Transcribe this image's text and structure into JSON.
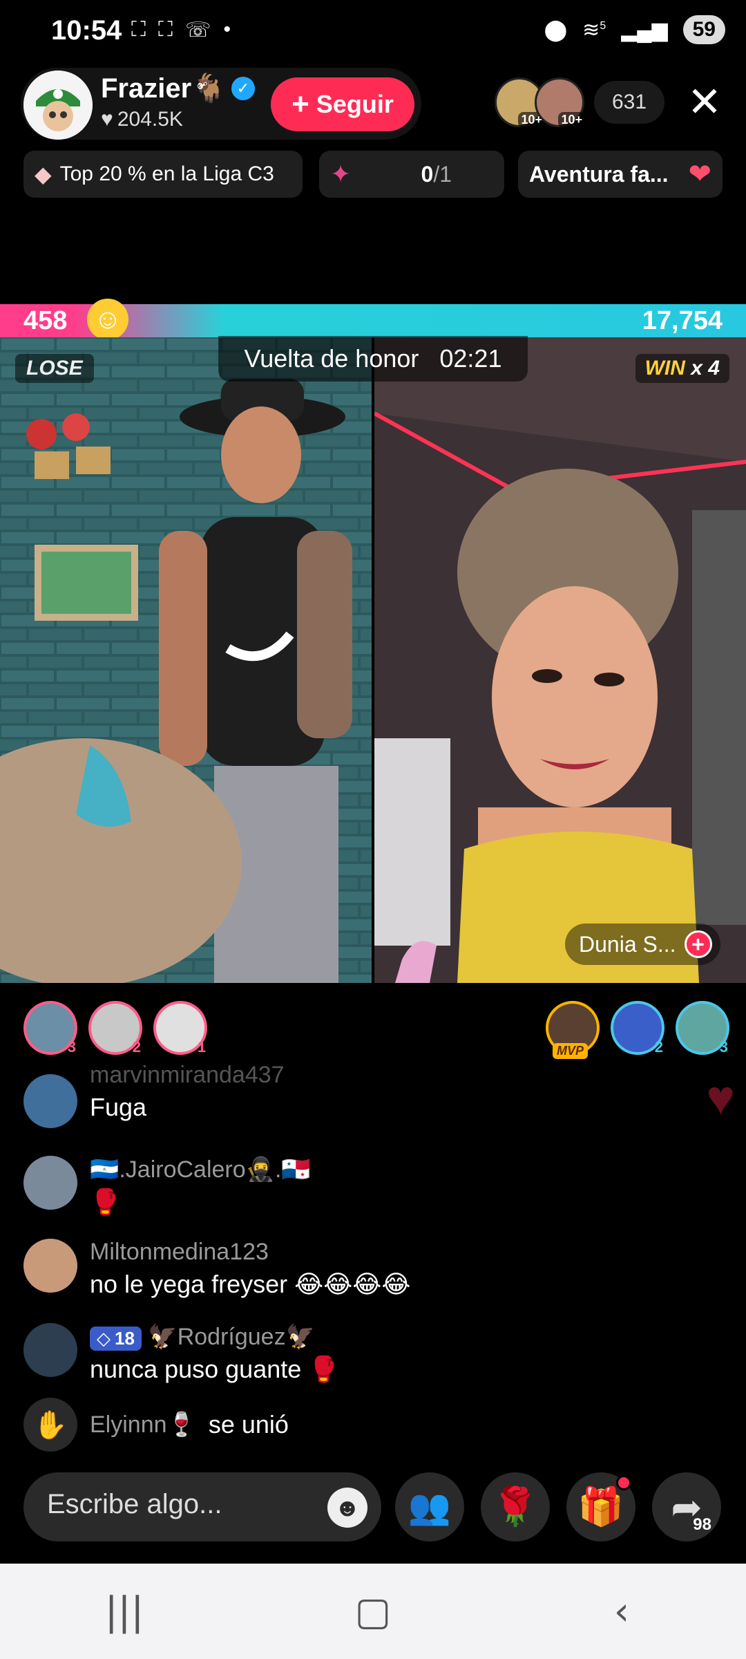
{
  "status": {
    "time": "10:54",
    "battery": "59",
    "left_icons": [
      "⌗",
      "⌗",
      "☏",
      "•"
    ],
    "network_superscript": "5"
  },
  "host": {
    "name": "Frazier🐐",
    "likes": "204.5K",
    "follow_label": "Seguir"
  },
  "viewers": {
    "badges": [
      "10+",
      "10+"
    ],
    "count": "631"
  },
  "chips": {
    "league": "Top 20 % en la Liga C3",
    "progress": "0",
    "progress_total": "/1",
    "adventure": "Aventura fa..."
  },
  "battle": {
    "left_score": "458",
    "right_score": "17,754",
    "result_left": "LOSE",
    "result_right_word": "WIN",
    "result_right_mult": "x 4",
    "timer_label": "Vuelta de honor",
    "timer_value": "02:21",
    "opponent_name": "Dunia S..."
  },
  "gifters_left": [
    {
      "rank": "3"
    },
    {
      "rank": "2"
    },
    {
      "rank": "1"
    }
  ],
  "gifters_right": [
    {
      "tag": "MVP"
    },
    {
      "rank": "2"
    },
    {
      "rank": "3"
    }
  ],
  "comments": [
    {
      "user": "marvinmiranda437",
      "text": "Fuga"
    },
    {
      "user": "🇳🇮.JairoCalero🥷.🇵🇦",
      "text": "🥊"
    },
    {
      "user": "Miltonmedina123",
      "text": "no le yega freyser 😂😂😂😂"
    },
    {
      "user": "🦅Rodríguez🦅",
      "badge": "18",
      "text": "nunca puso guante 🥊"
    }
  ],
  "joined": {
    "user": "Elyinnn🍷",
    "text": "se unió"
  },
  "bottom": {
    "placeholder": "Escribe algo...",
    "share_count": "98"
  },
  "colors": {
    "accent": "#fe2c55",
    "battle_left": "#ff3d8b",
    "battle_right": "#28d1d9"
  }
}
